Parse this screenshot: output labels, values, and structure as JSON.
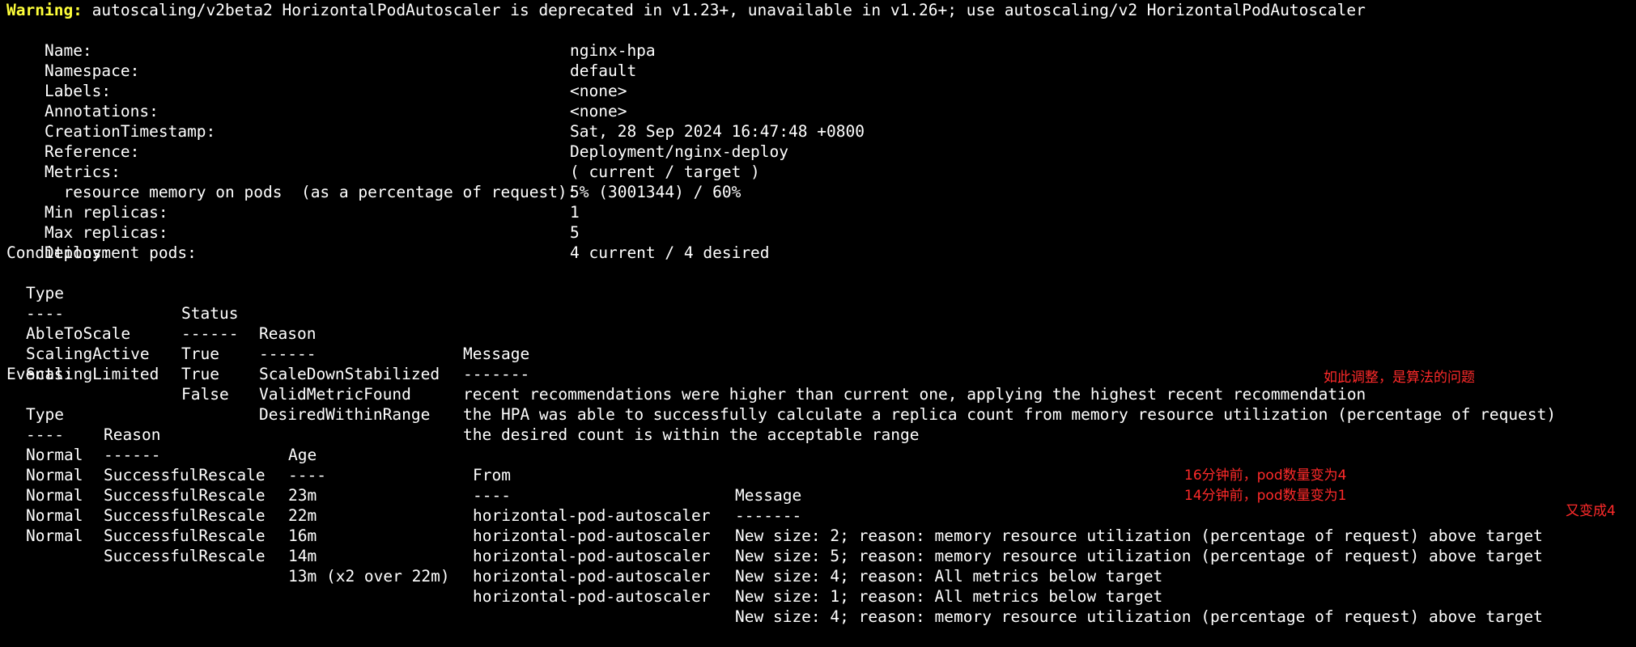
{
  "warning": {
    "label": "Warning:",
    "text": " autoscaling/v2beta2 HorizontalPodAutoscaler is deprecated in v1.23+, unavailable in v1.26+; use autoscaling/v2 HorizontalPodAutoscaler"
  },
  "fields": [
    {
      "key": "Name:",
      "value": "nginx-hpa"
    },
    {
      "key": "Namespace:",
      "value": "default"
    },
    {
      "key": "Labels:",
      "value": "<none>"
    },
    {
      "key": "Annotations:",
      "value": "<none>"
    },
    {
      "key": "CreationTimestamp:",
      "value": "Sat, 28 Sep 2024 16:47:48 +0800"
    },
    {
      "key": "Reference:",
      "value": "Deployment/nginx-deploy"
    },
    {
      "key": "Metrics:",
      "value": "( current / target )"
    },
    {
      "key": "  resource memory on pods  (as a percentage of request):",
      "value": "5% (3001344) / 60%"
    },
    {
      "key": "Min replicas:",
      "value": "1"
    },
    {
      "key": "Max replicas:",
      "value": "5"
    },
    {
      "key": "Deployment pods:",
      "value": "4 current / 4 desired"
    }
  ],
  "conditions": {
    "title": "Conditions:",
    "headers": [
      "Type",
      "Status",
      "Reason",
      "Message"
    ],
    "dashes": [
      "----",
      "------",
      "------",
      "-------"
    ],
    "rows": [
      [
        "AbleToScale",
        "True",
        "ScaleDownStabilized",
        "recent recommendations were higher than current one, applying the highest recent recommendation"
      ],
      [
        "ScalingActive",
        "True",
        "ValidMetricFound",
        "the HPA was able to successfully calculate a replica count from memory resource utilization (percentage of request)"
      ],
      [
        "ScalingLimited",
        "False",
        "DesiredWithinRange",
        "the desired count is within the acceptable range"
      ]
    ]
  },
  "events": {
    "title": "Events:",
    "headers": [
      "Type",
      "Reason",
      "Age",
      "From",
      "Message"
    ],
    "dashes": [
      "----",
      "------",
      "----",
      "----",
      "-------"
    ],
    "rows": [
      [
        "Normal",
        "SuccessfulRescale",
        "23m",
        "horizontal-pod-autoscaler",
        "New size: 2; reason: memory resource utilization (percentage of request) above target"
      ],
      [
        "Normal",
        "SuccessfulRescale",
        "22m",
        "horizontal-pod-autoscaler",
        "New size: 5; reason: memory resource utilization (percentage of request) above target"
      ],
      [
        "Normal",
        "SuccessfulRescale",
        "16m",
        "horizontal-pod-autoscaler",
        "New size: 4; reason: All metrics below target"
      ],
      [
        "Normal",
        "SuccessfulRescale",
        "14m",
        "horizontal-pod-autoscaler",
        "New size: 1; reason: All metrics below target"
      ],
      [
        "Normal",
        "SuccessfulRescale",
        "13m (x2 over 22m)",
        "horizontal-pod-autoscaler",
        "New size: 4; reason: memory resource utilization (percentage of request) above target"
      ]
    ]
  },
  "annotations": {
    "header_note": "如此调整，是算法的问题",
    "row16_note": "16分钟前，pod数量变为4",
    "row14_note": "14分钟前，pod数量变为1",
    "row13_note": "又变成4"
  },
  "colors": {
    "background": "#000000",
    "text": "#ffffff",
    "warning": "#ffff3a",
    "annotation": "#ff2a2a"
  }
}
